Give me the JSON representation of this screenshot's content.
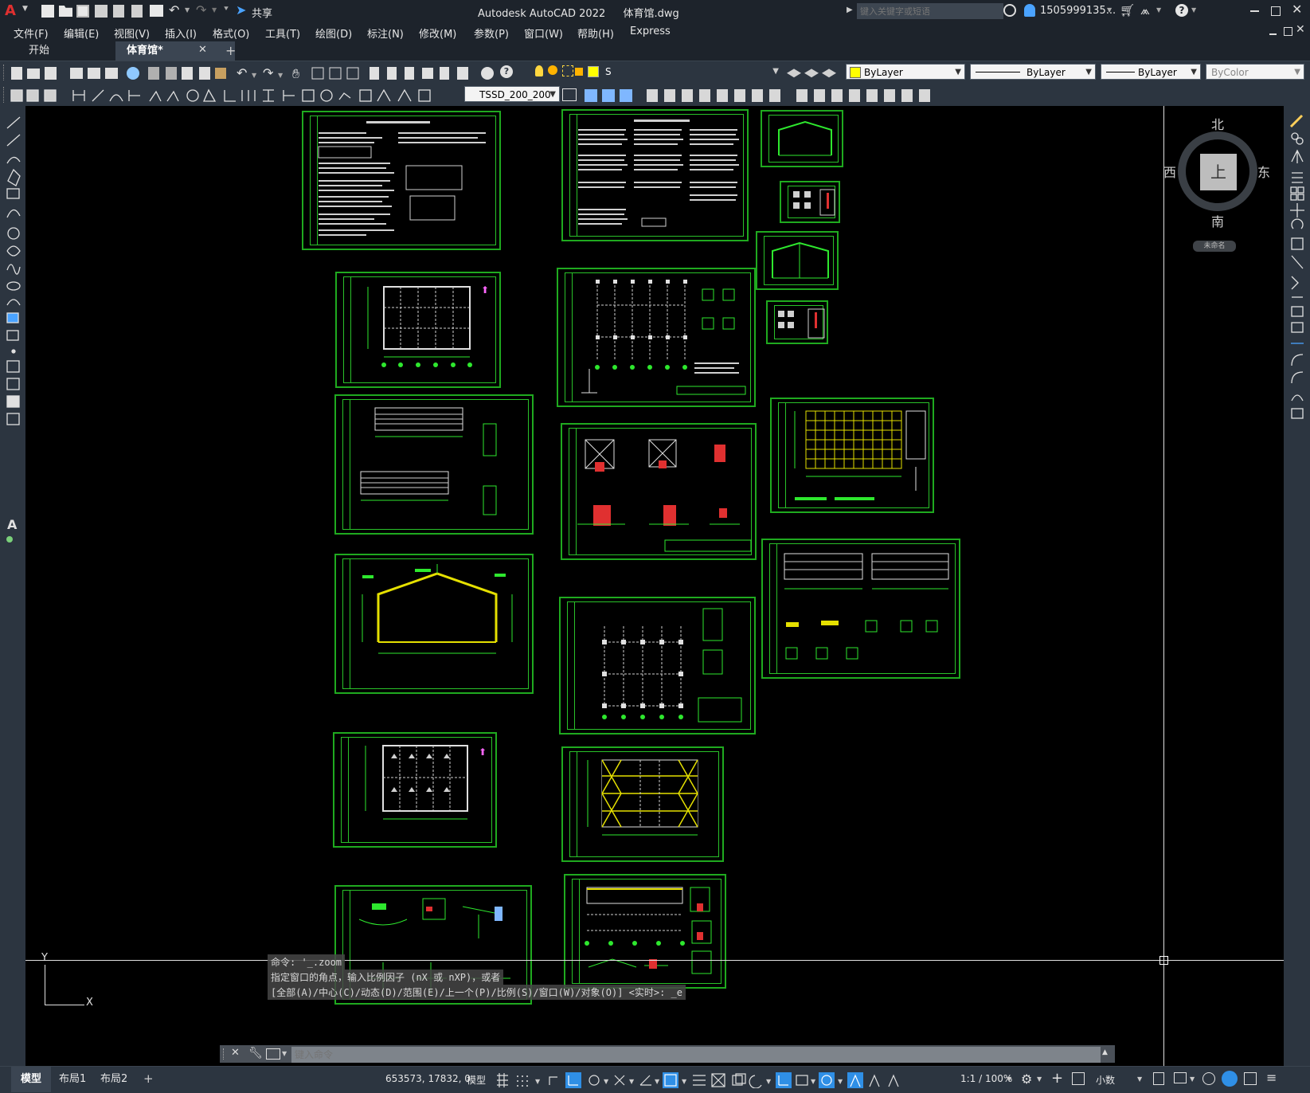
{
  "app": {
    "title": "Autodesk AutoCAD 2022",
    "filename": "体育馆.dwg",
    "search_placeholder": "键入关键字或短语",
    "user": "1505999135..."
  },
  "quick_access": {
    "share_label": "共享"
  },
  "menu": [
    "文件(F)",
    "编辑(E)",
    "视图(V)",
    "插入(I)",
    "格式(O)",
    "工具(T)",
    "绘图(D)",
    "标注(N)",
    "修改(M)",
    "参数(P)",
    "窗口(W)",
    "帮助(H)",
    "Express"
  ],
  "tabs": {
    "start": "开始",
    "active": "体育馆*",
    "add": "+"
  },
  "properties": {
    "layer": "S",
    "color": "ByLayer",
    "linetype": "ByLayer",
    "lineweight": "ByLayer",
    "plotstyle": "ByColor",
    "dimstyle": "TSSD_200_200"
  },
  "viewcube": {
    "north": "北",
    "south": "南",
    "east": "东",
    "west": "西",
    "face": "上",
    "wcs": "未命名"
  },
  "ucs": {
    "x": "X",
    "y": "Y"
  },
  "command": {
    "history": [
      "命令: '_.zoom",
      "指定窗口的角点，输入比例因子 (nX 或 nXP)，或者",
      "[全部(A)/中心(C)/动态(D)/范围(E)/上一个(P)/比例(S)/窗口(W)/对象(O)] <实时>: _e"
    ],
    "placeholder": "键入命令"
  },
  "layout_tabs": [
    "模型",
    "布局1",
    "布局2"
  ],
  "status": {
    "coords": "653573, 17832, 0",
    "model": "模型",
    "scale": "1:1 / 100%",
    "units": "小数"
  },
  "colors": {
    "sheet_border": "#1faa1f",
    "canvas": "#000000",
    "chrome": "#2c3540",
    "accent": "#2f8fe6"
  }
}
